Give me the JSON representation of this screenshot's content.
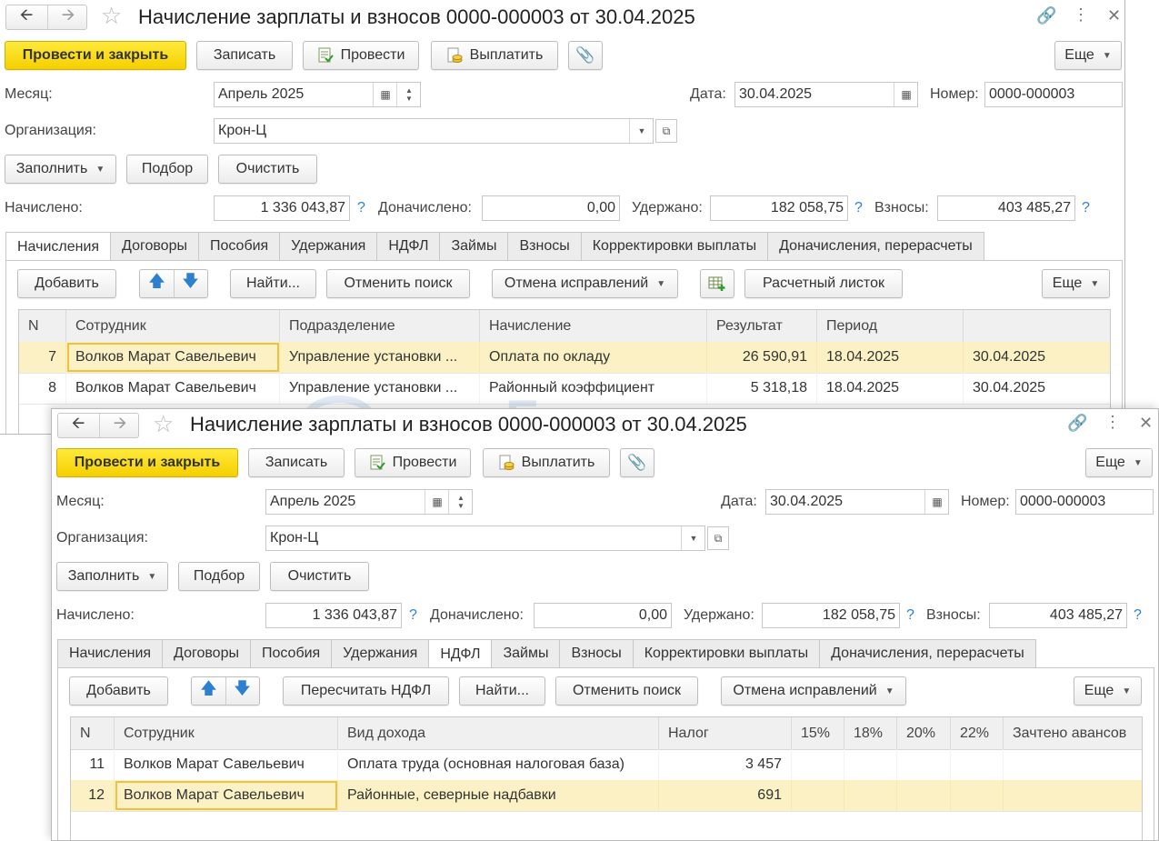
{
  "window1": {
    "title": "Начисление зарплаты и взносов 0000-000003 от 30.04.2025",
    "toolbar": {
      "post_close": "Провести и закрыть",
      "save": "Записать",
      "post": "Провести",
      "pay": "Выплатить",
      "more": "Еще"
    },
    "month_label": "Месяц:",
    "month_value": "Апрель 2025",
    "date_label": "Дата:",
    "date_value": "30.04.2025",
    "number_label": "Номер:",
    "number_value": "0000-000003",
    "org_label": "Организация:",
    "org_value": "Крон-Ц",
    "fill_btn": "Заполнить",
    "select_btn": "Подбор",
    "clear_btn": "Очистить",
    "accrued_label": "Начислено:",
    "accrued_value": "1 336 043,87",
    "extra_label": "Доначислено:",
    "extra_value": "0,00",
    "withheld_label": "Удержано:",
    "withheld_value": "182 058,75",
    "contrib_label": "Взносы:",
    "contrib_value": "403 485,27",
    "help": "?",
    "tabs": [
      "Начисления",
      "Договоры",
      "Пособия",
      "Удержания",
      "НДФЛ",
      "Займы",
      "Взносы",
      "Корректировки выплаты",
      "Доначисления, перерасчеты"
    ],
    "panel": {
      "add": "Добавить",
      "find": "Найти...",
      "cancel_search": "Отменить поиск",
      "cancel_fix": "Отмена исправлений",
      "payslip": "Расчетный листок",
      "more": "Еще"
    },
    "grid": {
      "headers": [
        "N",
        "Сотрудник",
        "Подразделение",
        "Начисление",
        "Результат",
        "Период",
        ""
      ],
      "rows": [
        [
          "7",
          "Волков Марат Савельевич",
          "Управление установки ...",
          "Оплата по окладу",
          "26 590,91",
          "18.04.2025",
          "30.04.2025"
        ],
        [
          "8",
          "Волков Марат Савельевич",
          "Управление установки ...",
          "Районный коэффициент",
          "5 318,18",
          "18.04.2025",
          "30.04.2025"
        ]
      ]
    }
  },
  "window2": {
    "title": "Начисление зарплаты и взносов 0000-000003 от 30.04.2025",
    "toolbar": {
      "post_close": "Провести и закрыть",
      "save": "Записать",
      "post": "Провести",
      "pay": "Выплатить",
      "more": "Еще"
    },
    "month_label": "Месяц:",
    "month_value": "Апрель 2025",
    "date_label": "Дата:",
    "date_value": "30.04.2025",
    "number_label": "Номер:",
    "number_value": "0000-000003",
    "org_label": "Организация:",
    "org_value": "Крон-Ц",
    "fill_btn": "Заполнить",
    "select_btn": "Подбор",
    "clear_btn": "Очистить",
    "accrued_label": "Начислено:",
    "accrued_value": "1 336 043,87",
    "extra_label": "Доначислено:",
    "extra_value": "0,00",
    "withheld_label": "Удержано:",
    "withheld_value": "182 058,75",
    "contrib_label": "Взносы:",
    "contrib_value": "403 485,27",
    "help": "?",
    "tabs": [
      "Начисления",
      "Договоры",
      "Пособия",
      "Удержания",
      "НДФЛ",
      "Займы",
      "Взносы",
      "Корректировки выплаты",
      "Доначисления, перерасчеты"
    ],
    "panel": {
      "add": "Добавить",
      "recalc": "Пересчитать НДФЛ",
      "find": "Найти...",
      "cancel_search": "Отменить поиск",
      "cancel_fix": "Отмена исправлений",
      "more": "Еще"
    },
    "grid": {
      "headers": [
        "N",
        "Сотрудник",
        "Вид дохода",
        "Налог",
        "15%",
        "18%",
        "20%",
        "22%",
        "Зачтено авансов"
      ],
      "rows": [
        [
          "11",
          "Волков Марат Савельевич",
          "Оплата труда (основная налоговая база)",
          "3 457",
          "",
          "",
          "",
          "",
          ""
        ],
        [
          "12",
          "Волков Марат Савельевич",
          "Районные, северные надбавки",
          "691",
          "",
          "",
          "",
          "",
          ""
        ]
      ]
    }
  },
  "watermark": "Бухэксперт"
}
